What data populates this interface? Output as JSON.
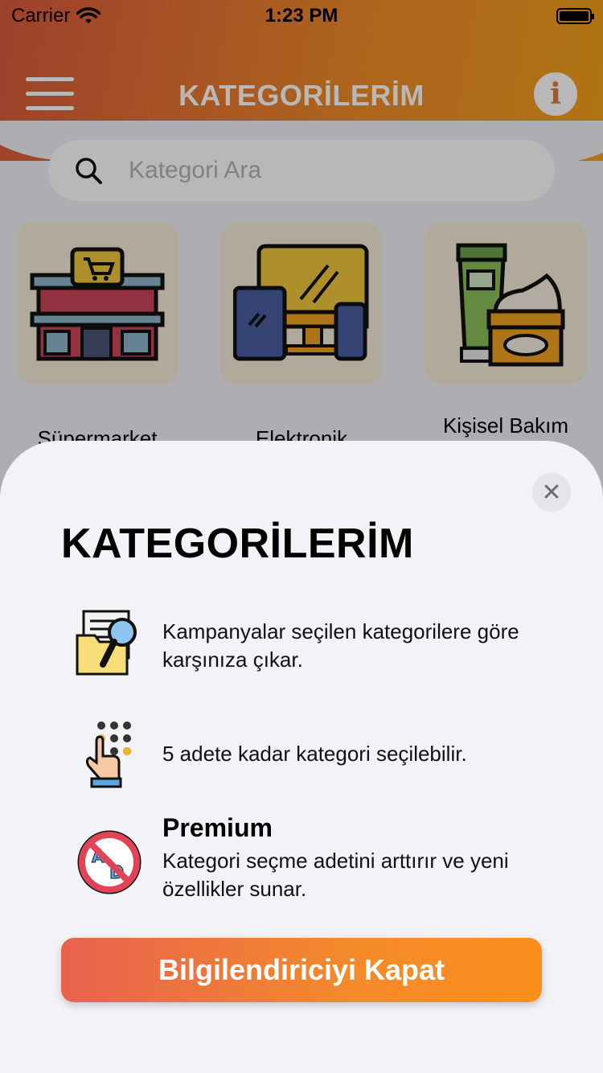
{
  "status_bar": {
    "carrier": "Carrier",
    "time": "1:23 PM"
  },
  "nav": {
    "title": "KATEGORİLERİM"
  },
  "search": {
    "placeholder": "Kategori Ara"
  },
  "categories": [
    {
      "label": "Süpermarket",
      "icon": "store-icon"
    },
    {
      "label": "Elektronik",
      "icon": "devices-icon"
    },
    {
      "label": "Kişisel Bakım",
      "icon": "cosmetics-icon"
    }
  ],
  "sheet": {
    "title": "KATEGORİLERİM",
    "features": [
      {
        "icon": "search-folder-icon",
        "text": "Kampanyalar seçilen kategorilere göre karşınıza çıkar."
      },
      {
        "icon": "touch-keypad-icon",
        "text": "5 adete kadar kategori seçilebilir."
      },
      {
        "icon": "no-ads-icon",
        "heading": "Premium",
        "text": "Kategori seçme adetini arttırır ve yeni özellikler sunar."
      }
    ],
    "button_label": "Bilgilendiriciyi Kapat"
  },
  "colors": {
    "accent_start": "#e8624f",
    "accent_end": "#fb8f1c",
    "sheet_background": "#f2f2f7"
  }
}
